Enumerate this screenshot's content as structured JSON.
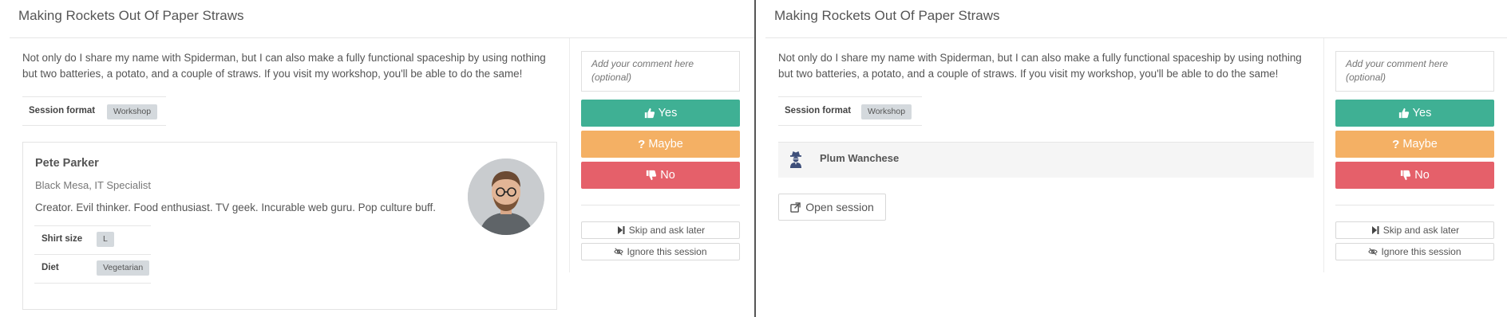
{
  "colors": {
    "yes": "#3fb094",
    "maybe": "#f4b064",
    "no": "#e5606a",
    "badge_bg": "#d4d9dd",
    "divider": "#555555"
  },
  "left_panel": {
    "title": "Making Rockets Out Of Paper Straws",
    "description": "Not only do I share my name with Spiderman, but I can also make a fully functional spaceship by using nothing but two batteries, a potato, and a couple of straws. If you visit my workshop, you'll be able to do the same!",
    "session_format_label": "Session format",
    "session_format_value": "Workshop",
    "speaker": {
      "name": "Pete Parker",
      "role": "Black Mesa, IT Specialist",
      "bio": "Creator. Evil thinker. Food enthusiast. TV geek. Incurable web guru. Pop culture buff.",
      "avatar_icon": "speaker-photo",
      "shirt_label": "Shirt size",
      "shirt_value": "L",
      "diet_label": "Diet",
      "diet_value": "Vegetarian"
    },
    "review": {
      "comment_placeholder": "Add your comment here (optional)",
      "yes_label": "Yes",
      "maybe_label": "Maybe",
      "no_label": "No",
      "skip_label": "Skip and ask later",
      "ignore_label": "Ignore this session"
    }
  },
  "right_panel": {
    "title": "Making Rockets Out Of Paper Straws",
    "description": "Not only do I share my name with Spiderman, but I can also make a fully functional spaceship by using nothing but two batteries, a potato, and a couple of straws. If you visit my workshop, you'll be able to do the same!",
    "session_format_label": "Session format",
    "session_format_value": "Workshop",
    "anonymous_speaker": {
      "name": "Plum Wanchese",
      "icon": "user-secret-icon"
    },
    "open_session_label": "Open session",
    "review": {
      "comment_placeholder": "Add your comment here (optional)",
      "yes_label": "Yes",
      "maybe_label": "Maybe",
      "no_label": "No",
      "skip_label": "Skip and ask later",
      "ignore_label": "Ignore this session"
    }
  }
}
